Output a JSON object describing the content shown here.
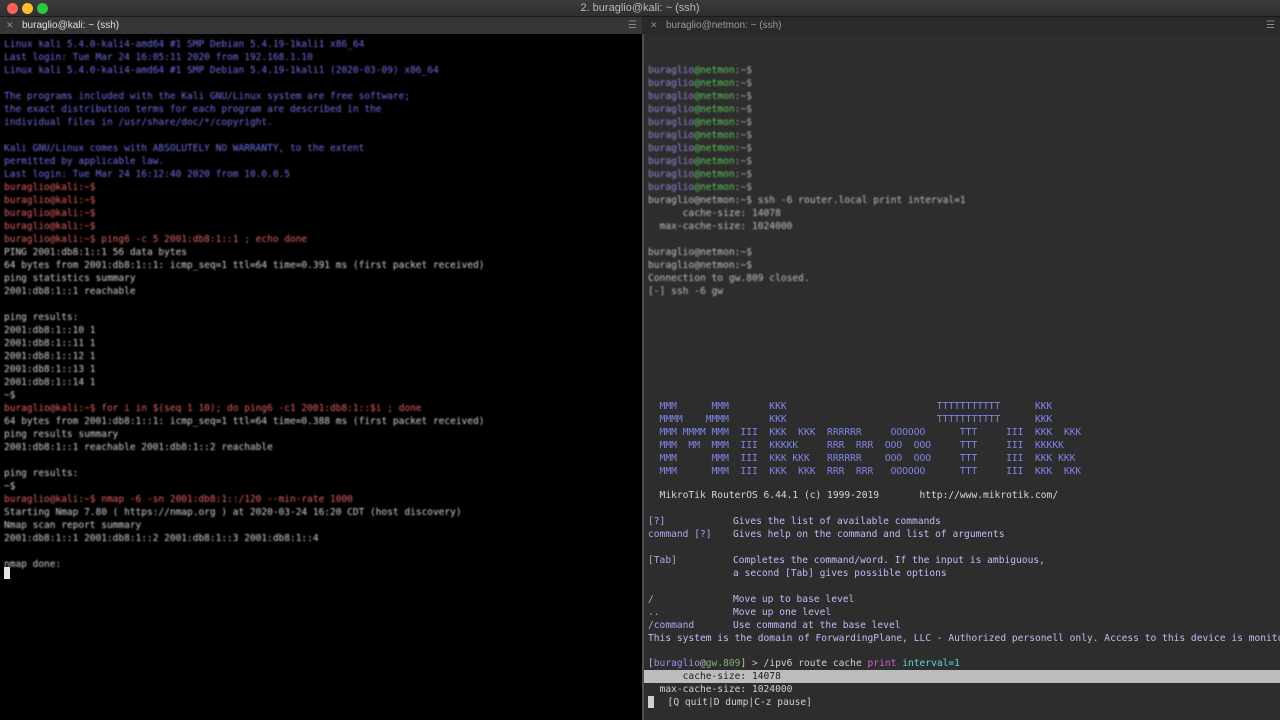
{
  "window": {
    "title": "2. buraglio@kali: ~ (ssh)"
  },
  "tabs": [
    {
      "label": "buraglio@kali: ~ (ssh)",
      "close": "✕"
    },
    {
      "label": "buraglio@netmon: ~ (ssh)",
      "close": "✕"
    }
  ],
  "tab_menu_icon": "☰",
  "left_terminal": {
    "lines": [
      {
        "text": "Linux kali 5.4.0-kali4-amd64 #1 SMP Debian 5.4.19-1kali1 x86_64",
        "color": "blue"
      },
      {
        "text": "Last login: Tue Mar 24 16:05:11 2020 from 192.168.1.10",
        "color": "blue"
      },
      {
        "text": "Linux kali 5.4.0-kali4-amd64 #1 SMP Debian 5.4.19-1kali1 (2020-03-09) x86_64",
        "color": "blue"
      },
      {
        "text": "",
        "color": "blue"
      },
      {
        "text": "The programs included with the Kali GNU/Linux system are free software;",
        "color": "blue"
      },
      {
        "text": "the exact distribution terms for each program are described in the",
        "color": "blue"
      },
      {
        "text": "individual files in /usr/share/doc/*/copyright.",
        "color": "blue"
      },
      {
        "text": "",
        "color": "blue"
      },
      {
        "text": "Kali GNU/Linux comes with ABSOLUTELY NO WARRANTY, to the extent",
        "color": "blue"
      },
      {
        "text": "permitted by applicable law.",
        "color": "blue"
      },
      {
        "text": "Last login: Tue Mar 24 16:12:40 2020 from 10.0.0.5",
        "color": "blue"
      },
      {
        "text": "buraglio@kali:~$",
        "color": "red"
      },
      {
        "text": "buraglio@kali:~$",
        "color": "red"
      },
      {
        "text": "buraglio@kali:~$",
        "color": "red"
      },
      {
        "text": "buraglio@kali:~$",
        "color": "red"
      },
      {
        "text": "buraglio@kali:~$ ping6 -c 5 2001:db8:1::1 ; echo done",
        "color": "red"
      },
      {
        "text": "PING 2001:db8:1::1 56 data bytes",
        "color": "white"
      },
      {
        "text": "64 bytes from 2001:db8:1::1: icmp_seq=1 ttl=64 time=0.391 ms (first packet received)",
        "color": "white"
      },
      {
        "text": "ping statistics summary",
        "color": "white"
      },
      {
        "text": "2001:db8:1::1 reachable",
        "color": "white"
      },
      {
        "text": "",
        "color": "white"
      },
      {
        "text": "ping results:",
        "color": "white"
      },
      {
        "text": "2001:db8:1::10 1",
        "color": "white"
      },
      {
        "text": "2001:db8:1::11 1",
        "color": "white"
      },
      {
        "text": "2001:db8:1::12 1",
        "color": "white"
      },
      {
        "text": "2001:db8:1::13 1",
        "color": "white"
      },
      {
        "text": "2001:db8:1::14 1",
        "color": "white"
      },
      {
        "text": "~$",
        "color": "white"
      },
      {
        "text": "buraglio@kali:~$ for i in $(seq 1 10); do ping6 -c1 2001:db8:1::$i ; done",
        "color": "red"
      },
      {
        "text": "64 bytes from 2001:db8:1::1: icmp_seq=1 ttl=64 time=0.388 ms (first packet received)",
        "color": "white"
      },
      {
        "text": "ping results summary",
        "color": "white"
      },
      {
        "text": "2001:db8:1::1 reachable 2001:db8:1::2 reachable",
        "color": "white"
      },
      {
        "text": "",
        "color": "white"
      },
      {
        "text": "ping results:",
        "color": "white"
      },
      {
        "text": "~$",
        "color": "white"
      },
      {
        "text": "buraglio@kali:~$ nmap -6 -sn 2001:db8:1::/120 --min-rate 1000",
        "color": "red"
      },
      {
        "text": "Starting Nmap 7.80 ( https://nmap.org ) at 2020-03-24 16:20 CDT (host discovery)",
        "color": "white"
      },
      {
        "text": "Nmap scan report summary",
        "color": "white"
      },
      {
        "text": "2001:db8:1::1 2001:db8:1::2 2001:db8:1::3 2001:db8:1::4",
        "color": "white"
      },
      {
        "text": "",
        "color": "white"
      },
      {
        "text": "nmap done:",
        "color": "white"
      }
    ]
  },
  "right_terminal": {
    "prompt_lines": [
      {
        "user": "buraglio",
        "host": "netmon",
        "suffix": "~$"
      },
      {
        "user": "buraglio",
        "host": "netmon",
        "suffix": "~$"
      },
      {
        "user": "buraglio",
        "host": "netmon",
        "suffix": "~$"
      },
      {
        "user": "buraglio",
        "host": "netmon",
        "suffix": "~$"
      },
      {
        "user": "buraglio",
        "host": "netmon",
        "suffix": "~$"
      },
      {
        "user": "buraglio",
        "host": "netmon",
        "suffix": "~$"
      },
      {
        "user": "buraglio",
        "host": "netmon",
        "suffix": "~$"
      },
      {
        "user": "buraglio",
        "host": "netmon",
        "suffix": "~$"
      },
      {
        "user": "buraglio",
        "host": "netmon",
        "suffix": "~$"
      },
      {
        "user": "buraglio",
        "host": "netmon",
        "suffix": "~$"
      }
    ],
    "prev_command": "buraglio@netmon:~$ ssh -6 router.local print interval=1",
    "prev_output_1": "      cache-size: 14078",
    "prev_output_2": "  max-cache-size: 1024000",
    "prompt_after_1": "buraglio@netmon:~$",
    "prompt_after_2": "buraglio@netmon:~$",
    "conn_closed": "Connection to gw.809 closed.",
    "ssh_line": "[-] ssh -6 gw",
    "logo_lines": [
      "  MMM      MMM       KKK                          TTTTTTTTTTT      KKK",
      "  MMMM    MMMM       KKK                          TTTTTTTTTTT      KKK",
      "  MMM MMMM MMM  III  KKK  KKK  RRRRRR     OOOOOO      TTT     III  KKK  KKK",
      "  MMM  MM  MMM  III  KKKKK     RRR  RRR  OOO  OOO     TTT     III  KKKKK",
      "  MMM      MMM  III  KKK KKK   RRRRRR    OOO  OOO     TTT     III  KKK KKK",
      "  MMM      MMM  III  KKK  KKK  RRR  RRR   OOOOOO      TTT     III  KKK  KKK"
    ],
    "banner": "  MikroTik RouterOS 6.44.1 (c) 1999-2019       http://www.mikrotik.com/",
    "help": [
      {
        "cmd": "[?]",
        "desc": "Gives the list of available commands"
      },
      {
        "cmd": "command [?]",
        "desc": "Gives help on the command and list of arguments"
      },
      {
        "cmd": "",
        "desc": ""
      },
      {
        "cmd": "[Tab]",
        "desc": "Completes the command/word. If the input is ambiguous,"
      },
      {
        "cmd": "",
        "desc": "a second [Tab] gives possible options"
      },
      {
        "cmd": "",
        "desc": ""
      },
      {
        "cmd": "/",
        "desc": "Move up to base level"
      },
      {
        "cmd": "..",
        "desc": "Move up one level"
      },
      {
        "cmd": "/command",
        "desc": "Use command at the base level"
      }
    ],
    "notice": "This system is the domain of ForwardingPlane, LLC - Authorized personell only. Access to this device is monitored, v...",
    "prompt": {
      "open": "[",
      "user": "buraglio",
      "at": "@",
      "host": "gw.809",
      "close": "] > ",
      "command": "/ipv6 route cache ",
      "keyword_print": "print",
      "space": " ",
      "keyword_interval": "interval=1"
    },
    "output_cache_size": "      cache-size: 14078",
    "output_max_cache_size": "  max-cache-size: 1024000",
    "status_line": "  [Q quit|D dump|C-z pause]"
  }
}
